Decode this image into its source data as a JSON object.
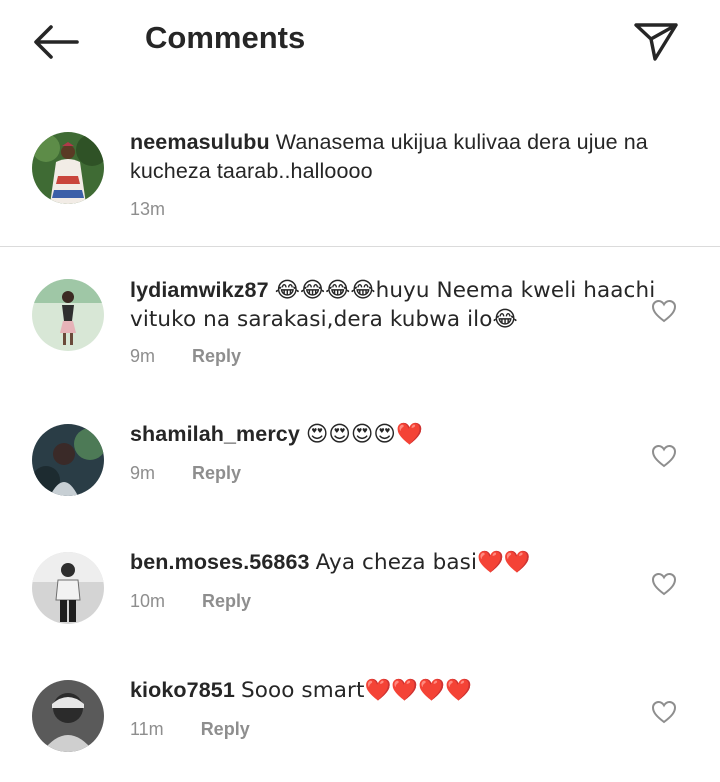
{
  "header": {
    "title": "Comments",
    "back_icon": "arrow-left-icon",
    "share_icon": "paper-plane-icon"
  },
  "caption": {
    "username": "neemasulubu",
    "text": "Wanasema ukijua kulivaa dera ujue na kucheza taarab..halloooo",
    "time": "13m"
  },
  "comments": [
    {
      "username": "lydiamwikz87",
      "text": "😂😂😂😂huyu Neema kweli haachi vituko na sarakasi,dera kubwa ilo😂",
      "time": "9m",
      "reply_label": "Reply"
    },
    {
      "username": "shamilah_mercy",
      "text": "😍😍😍😍❤️",
      "time": "9m",
      "reply_label": "Reply"
    },
    {
      "username": "ben.moses.56863",
      "text": "Aya cheza basi❤️❤️",
      "time": "10m",
      "reply_label": "Reply"
    },
    {
      "username": "kioko7851",
      "text": "Sooo smart❤️❤️❤️❤️",
      "time": "11m",
      "reply_label": "Reply"
    }
  ],
  "colors": {
    "text": "#262626",
    "secondary": "#8e8e8e",
    "divider": "#dbdbdb"
  }
}
